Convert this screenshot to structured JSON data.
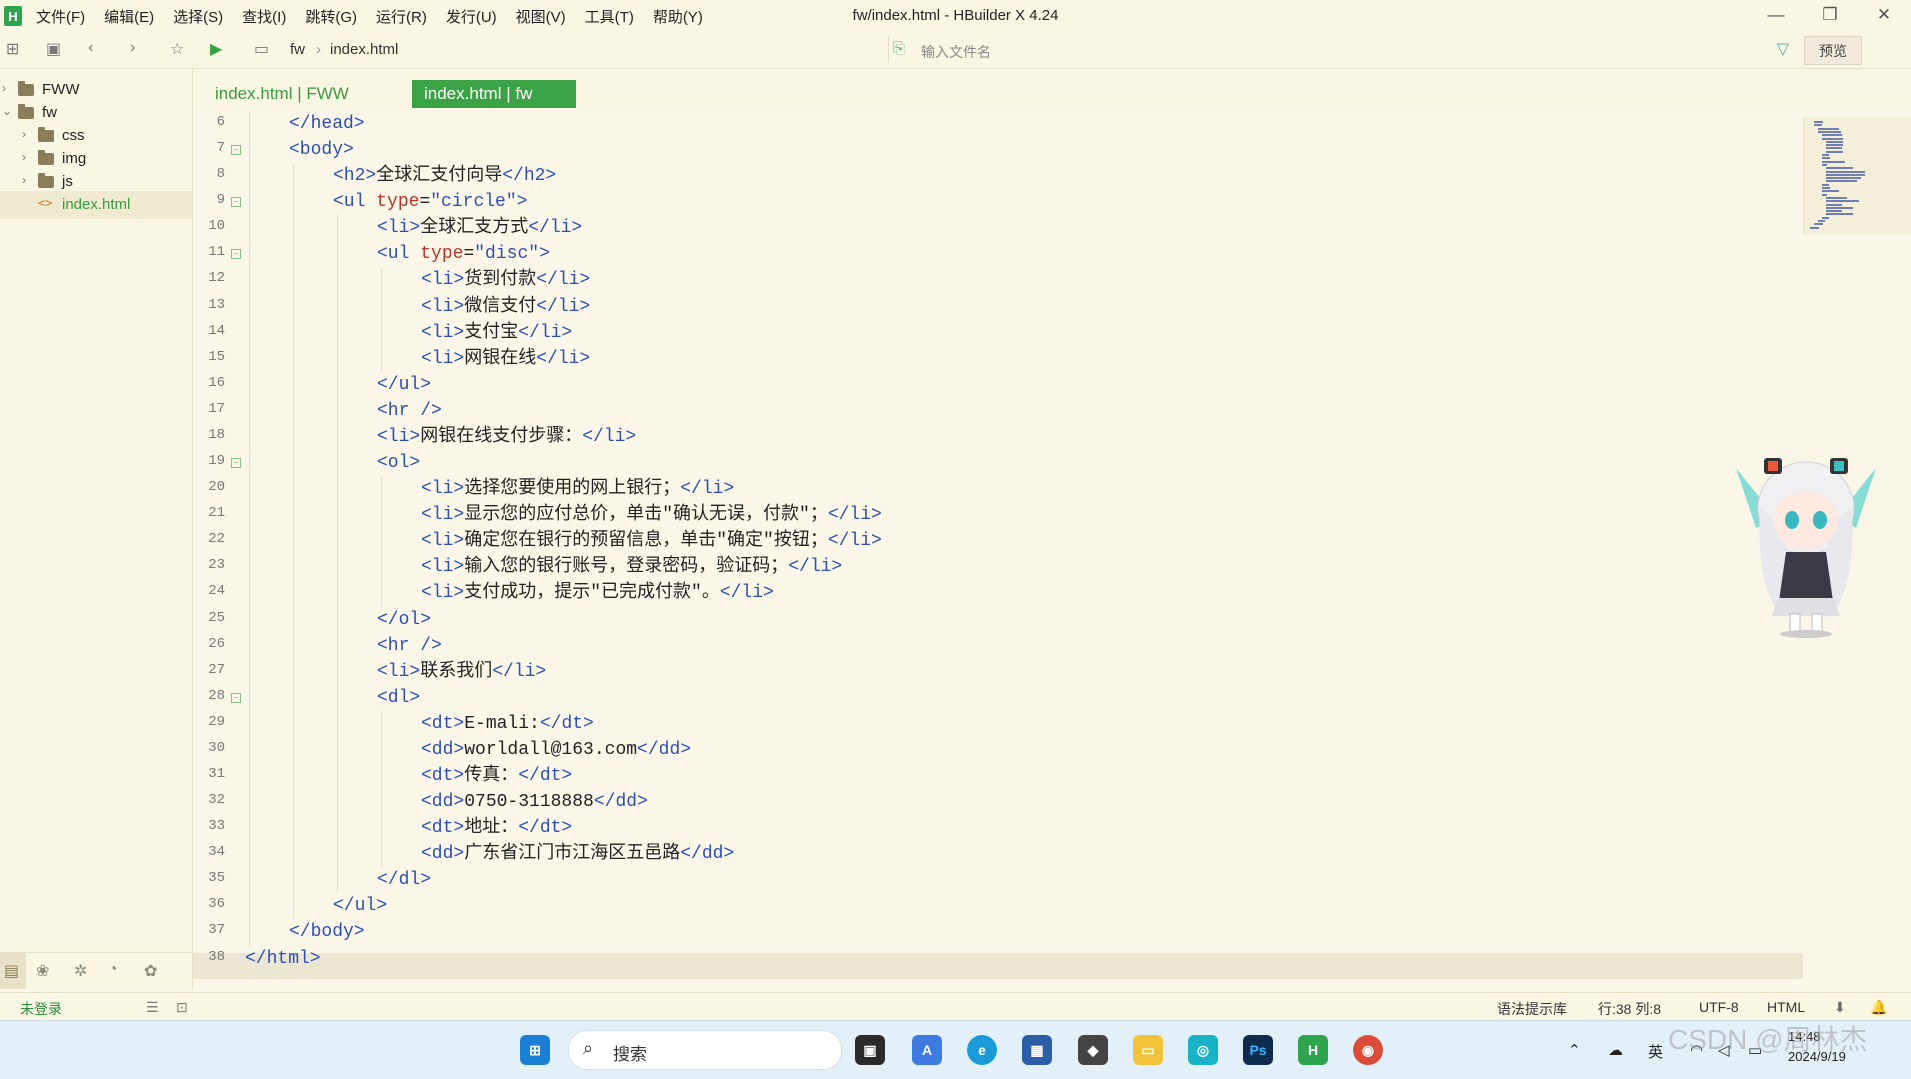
{
  "app": {
    "logo": "H",
    "title": "fw/index.html - HBuilder X 4.24",
    "menu": [
      "文件(F)",
      "编辑(E)",
      "选择(S)",
      "查找(I)",
      "跳转(G)",
      "运行(R)",
      "发行(U)",
      "视图(V)",
      "工具(T)",
      "帮助(Y)"
    ]
  },
  "toolbar": {
    "breadcrumb": [
      "fw",
      "index.html"
    ],
    "search_placeholder": "输入文件名",
    "preview_label": "预览"
  },
  "sidebar": {
    "tree": [
      {
        "label": "FWW",
        "type": "folder",
        "depth": 0,
        "expanded": false
      },
      {
        "label": "fw",
        "type": "folder",
        "depth": 0,
        "expanded": true
      },
      {
        "label": "css",
        "type": "folder",
        "depth": 1,
        "expanded": false
      },
      {
        "label": "img",
        "type": "folder",
        "depth": 1,
        "expanded": false
      },
      {
        "label": "js",
        "type": "folder",
        "depth": 1,
        "expanded": false
      },
      {
        "label": "index.html",
        "type": "file",
        "depth": 1,
        "selected": true
      }
    ]
  },
  "tabs": [
    {
      "label": "index.html | FWW",
      "active": false
    },
    {
      "label": "index.html | fw",
      "active": true
    }
  ],
  "editor": {
    "lines": [
      {
        "n": 6,
        "indent": 1,
        "code": [
          [
            "tag",
            "</head>"
          ]
        ]
      },
      {
        "n": 7,
        "indent": 1,
        "fold": true,
        "code": [
          [
            "tag",
            "<body>"
          ]
        ]
      },
      {
        "n": 8,
        "indent": 2,
        "code": [
          [
            "tag",
            "<h2>"
          ],
          [
            "txt",
            "全球汇支付向导"
          ],
          [
            "tag",
            "</h2>"
          ]
        ]
      },
      {
        "n": 9,
        "indent": 2,
        "fold": true,
        "code": [
          [
            "tag",
            "<ul "
          ],
          [
            "attr",
            "type"
          ],
          [
            "txt",
            "="
          ],
          [
            "val",
            "\"circle\""
          ],
          [
            "tag",
            ">"
          ]
        ]
      },
      {
        "n": 10,
        "indent": 3,
        "code": [
          [
            "tag",
            "<li>"
          ],
          [
            "txt",
            "全球汇支方式"
          ],
          [
            "tag",
            "</li>"
          ]
        ]
      },
      {
        "n": 11,
        "indent": 3,
        "fold": true,
        "code": [
          [
            "tag",
            "<ul "
          ],
          [
            "attr",
            "type"
          ],
          [
            "txt",
            "="
          ],
          [
            "val",
            "\"disc\""
          ],
          [
            "tag",
            ">"
          ]
        ]
      },
      {
        "n": 12,
        "indent": 4,
        "code": [
          [
            "tag",
            "<li>"
          ],
          [
            "txt",
            "货到付款"
          ],
          [
            "tag",
            "</li>"
          ]
        ]
      },
      {
        "n": 13,
        "indent": 4,
        "code": [
          [
            "tag",
            "<li>"
          ],
          [
            "txt",
            "微信支付"
          ],
          [
            "tag",
            "</li>"
          ]
        ]
      },
      {
        "n": 14,
        "indent": 4,
        "code": [
          [
            "tag",
            "<li>"
          ],
          [
            "txt",
            "支付宝"
          ],
          [
            "tag",
            "</li>"
          ]
        ]
      },
      {
        "n": 15,
        "indent": 4,
        "code": [
          [
            "tag",
            "<li>"
          ],
          [
            "txt",
            "网银在线"
          ],
          [
            "tag",
            "</li>"
          ]
        ]
      },
      {
        "n": 16,
        "indent": 3,
        "code": [
          [
            "tag",
            "</ul>"
          ]
        ]
      },
      {
        "n": 17,
        "indent": 3,
        "code": [
          [
            "tag",
            "<hr />"
          ]
        ]
      },
      {
        "n": 18,
        "indent": 3,
        "code": [
          [
            "tag",
            "<li>"
          ],
          [
            "txt",
            "网银在线支付步骤："
          ],
          [
            "tag",
            "</li>"
          ]
        ]
      },
      {
        "n": 19,
        "indent": 3,
        "fold": true,
        "code": [
          [
            "tag",
            "<ol>"
          ]
        ]
      },
      {
        "n": 20,
        "indent": 4,
        "code": [
          [
            "tag",
            "<li>"
          ],
          [
            "txt",
            "选择您要使用的网上银行；"
          ],
          [
            "tag",
            "</li>"
          ]
        ]
      },
      {
        "n": 21,
        "indent": 4,
        "code": [
          [
            "tag",
            "<li>"
          ],
          [
            "txt",
            "显示您的应付总价，单击\"确认无误，付款\"；"
          ],
          [
            "tag",
            "</li>"
          ]
        ]
      },
      {
        "n": 22,
        "indent": 4,
        "code": [
          [
            "tag",
            "<li>"
          ],
          [
            "txt",
            "确定您在银行的预留信息，单击\"确定\"按钮；"
          ],
          [
            "tag",
            "</li>"
          ]
        ]
      },
      {
        "n": 23,
        "indent": 4,
        "code": [
          [
            "tag",
            "<li>"
          ],
          [
            "txt",
            "输入您的银行账号，登录密码，验证码；"
          ],
          [
            "tag",
            "</li>"
          ]
        ]
      },
      {
        "n": 24,
        "indent": 4,
        "code": [
          [
            "tag",
            "<li>"
          ],
          [
            "txt",
            "支付成功，提示\"已完成付款\"。"
          ],
          [
            "tag",
            "</li>"
          ]
        ]
      },
      {
        "n": 25,
        "indent": 3,
        "code": [
          [
            "tag",
            "</ol>"
          ]
        ]
      },
      {
        "n": 26,
        "indent": 3,
        "code": [
          [
            "tag",
            "<hr />"
          ]
        ]
      },
      {
        "n": 27,
        "indent": 3,
        "code": [
          [
            "tag",
            "<li>"
          ],
          [
            "txt",
            "联系我们"
          ],
          [
            "tag",
            "</li>"
          ]
        ]
      },
      {
        "n": 28,
        "indent": 3,
        "fold": true,
        "code": [
          [
            "tag",
            "<dl>"
          ]
        ]
      },
      {
        "n": 29,
        "indent": 4,
        "code": [
          [
            "tag",
            "<dt>"
          ],
          [
            "txt",
            "E-mali:"
          ],
          [
            "tag",
            "</dt>"
          ]
        ]
      },
      {
        "n": 30,
        "indent": 4,
        "code": [
          [
            "tag",
            "<dd>"
          ],
          [
            "txt",
            "worldall@163.com"
          ],
          [
            "tag",
            "</dd>"
          ]
        ]
      },
      {
        "n": 31,
        "indent": 4,
        "code": [
          [
            "tag",
            "<dt>"
          ],
          [
            "txt",
            "传真："
          ],
          [
            "tag",
            "</dt>"
          ]
        ]
      },
      {
        "n": 32,
        "indent": 4,
        "code": [
          [
            "tag",
            "<dd>"
          ],
          [
            "txt",
            "0750-3118888"
          ],
          [
            "tag",
            "</dd>"
          ]
        ]
      },
      {
        "n": 33,
        "indent": 4,
        "code": [
          [
            "tag",
            "<dt>"
          ],
          [
            "txt",
            "地址："
          ],
          [
            "tag",
            "</dt>"
          ]
        ]
      },
      {
        "n": 34,
        "indent": 4,
        "code": [
          [
            "tag",
            "<dd>"
          ],
          [
            "txt",
            "广东省江门市江海区五邑路"
          ],
          [
            "tag",
            "</dd>"
          ]
        ]
      },
      {
        "n": 35,
        "indent": 3,
        "code": [
          [
            "tag",
            "</dl>"
          ]
        ]
      },
      {
        "n": 36,
        "indent": 2,
        "code": [
          [
            "tag",
            "</ul>"
          ]
        ]
      },
      {
        "n": 37,
        "indent": 1,
        "code": [
          [
            "tag",
            "</body>"
          ]
        ]
      },
      {
        "n": 38,
        "indent": 0,
        "code": [
          [
            "tag",
            "</html>"
          ]
        ],
        "current": true
      }
    ]
  },
  "status": {
    "login": "未登录",
    "syntax_lib": "语法提示库",
    "position": "行:38  列:8",
    "encoding": "UTF-8",
    "language": "HTML"
  },
  "taskbar": {
    "search_label": "搜索",
    "ime": "英",
    "time": "14:48",
    "date": "2024/9/19"
  },
  "watermark": "CSDN @周林杰",
  "colors": {
    "accent": "#3aa345",
    "tag": "#2d4fb3",
    "attr": "#b5352b",
    "editor_bg": "#faf7e8"
  }
}
